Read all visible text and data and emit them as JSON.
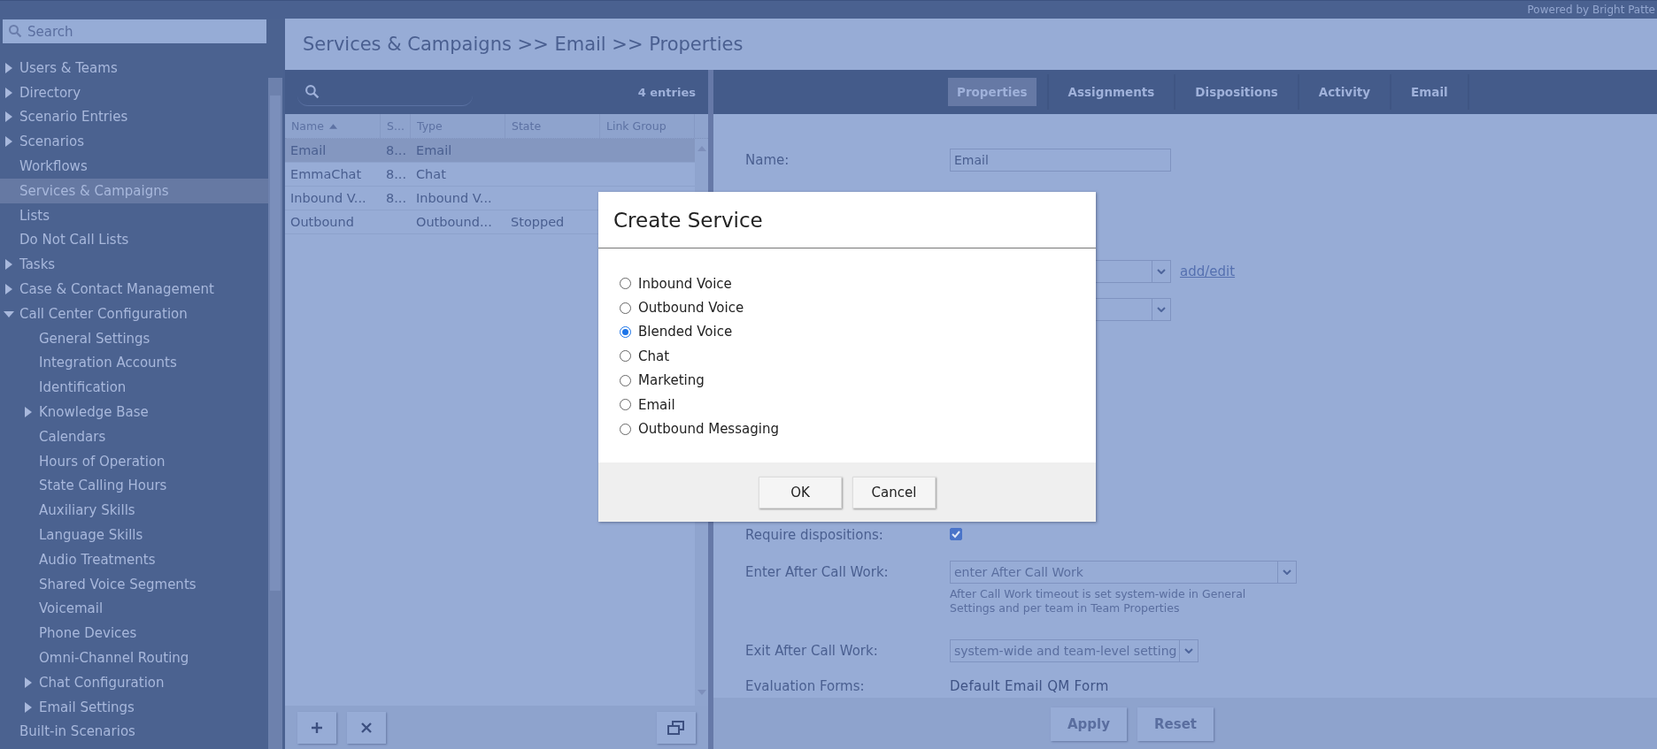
{
  "top_bar": {
    "powered_by": "Powered by Bright Patte"
  },
  "sidebar": {
    "search": {
      "placeholder": "Search"
    },
    "items": [
      {
        "label": "Users & Teams",
        "expanded": false,
        "selected": false
      },
      {
        "label": "Directory",
        "expanded": false,
        "selected": false
      },
      {
        "label": "Scenario Entries",
        "expanded": false,
        "selected": false
      },
      {
        "label": "Scenarios",
        "expanded": false,
        "selected": false
      },
      {
        "label": "Workflows",
        "selected": false
      },
      {
        "label": "Services & Campaigns",
        "selected": true
      },
      {
        "label": "Lists",
        "selected": false
      },
      {
        "label": "Do Not Call Lists",
        "selected": false
      },
      {
        "label": "Tasks",
        "expanded": false,
        "selected": false
      },
      {
        "label": "Case & Contact Management",
        "expanded": false,
        "selected": false
      },
      {
        "label": "Call Center Configuration",
        "expanded": true,
        "selected": false,
        "children": [
          {
            "label": "General Settings",
            "selected": false
          },
          {
            "label": "Integration Accounts",
            "selected": false
          },
          {
            "label": "Identification",
            "selected": false
          },
          {
            "label": "Knowledge Base",
            "expanded": false,
            "selected": false
          },
          {
            "label": "Calendars",
            "selected": false
          },
          {
            "label": "Hours of Operation",
            "selected": false
          },
          {
            "label": "State Calling Hours",
            "selected": false
          },
          {
            "label": "Auxiliary Skills",
            "selected": false
          },
          {
            "label": "Language Skills",
            "selected": false
          },
          {
            "label": "Audio Treatments",
            "selected": false
          },
          {
            "label": "Shared Voice Segments",
            "selected": false
          },
          {
            "label": "Voicemail",
            "selected": false
          },
          {
            "label": "Phone Devices",
            "selected": false
          },
          {
            "label": "Omni-Channel Routing",
            "selected": false
          },
          {
            "label": "Chat Configuration",
            "expanded": false,
            "selected": false
          },
          {
            "label": "Email Settings",
            "expanded": false,
            "selected": false
          }
        ]
      },
      {
        "label": "Built-in Scenarios",
        "selected": false
      }
    ]
  },
  "page_title": "Services & Campaigns >> Email >> Properties",
  "list": {
    "count": "4 entries",
    "columns": [
      {
        "label": "Name",
        "sorted": true
      },
      {
        "label": "S...",
        "sorted": false
      },
      {
        "label": "Type",
        "sorted": false
      },
      {
        "label": "State",
        "sorted": false
      },
      {
        "label": "Link Group",
        "sorted": false
      }
    ],
    "rows": [
      {
        "cells": [
          "Email",
          "8...",
          "Email",
          "",
          ""
        ],
        "selected": true
      },
      {
        "cells": [
          "EmmaChat",
          "8...",
          "Chat",
          "",
          ""
        ],
        "selected": false
      },
      {
        "cells": [
          "Inbound V...",
          "8...",
          "Inbound V...",
          "",
          ""
        ],
        "selected": false
      },
      {
        "cells": [
          "Outbound",
          "",
          "Outbound...",
          "Stopped",
          ""
        ],
        "selected": false
      }
    ]
  },
  "tabs": [
    {
      "label": "Properties",
      "selected": true
    },
    {
      "label": "Assignments",
      "selected": false
    },
    {
      "label": "Dispositions",
      "selected": false
    },
    {
      "label": "Activity",
      "selected": false
    },
    {
      "label": "Email",
      "selected": false
    }
  ],
  "form": {
    "fields": [
      {
        "kind": "input",
        "label": "Name:",
        "value": "Email"
      },
      {
        "kind": "select",
        "link": "add/edit"
      },
      {
        "kind": "select"
      },
      {
        "kind": "checkbox",
        "label": "Require dispositions:",
        "checked": true
      },
      {
        "kind": "select",
        "label": "Enter After Call Work:",
        "placeholder": "enter After Call Work",
        "disabled": true,
        "hint": "After Call Work timeout is set system-wide in General Settings and per team in Team Properties"
      },
      {
        "kind": "select",
        "label": "Exit After Call Work:",
        "value": "system-wide and team-level setting",
        "disabled": true
      },
      {
        "kind": "text",
        "label": "Evaluation Forms:",
        "value": "Default Email QM Form"
      }
    ]
  },
  "buttons": [
    "Apply",
    "Reset"
  ],
  "dialog": {
    "title": "Create Service",
    "options": [
      {
        "label": "Inbound Voice",
        "selected": false
      },
      {
        "label": "Outbound Voice",
        "selected": false
      },
      {
        "label": "Blended Voice",
        "selected": true
      },
      {
        "label": "Chat",
        "selected": false
      },
      {
        "label": "Marketing",
        "selected": false
      },
      {
        "label": "Email",
        "selected": false
      },
      {
        "label": "Outbound Messaging",
        "selected": false
      }
    ],
    "buttons": [
      "OK",
      "Cancel"
    ]
  }
}
